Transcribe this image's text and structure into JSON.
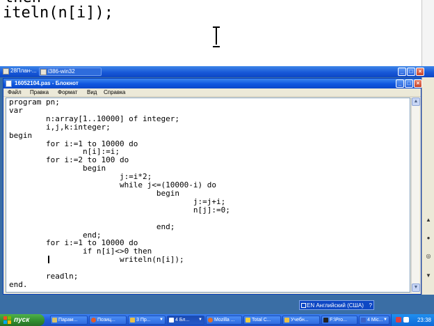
{
  "top_editor": {
    "partial_line": "then",
    "code_line": "iteln(n[i]);"
  },
  "outer_window": {
    "tabs": [
      {
        "label": "28План-..."
      },
      {
        "label": "i386-win32"
      }
    ]
  },
  "notepad": {
    "title": "16052104.pas - Блокнот",
    "menu": [
      "Файл",
      "Правка",
      "Формат",
      "Вид",
      "Справка"
    ],
    "code": "program pn;\nvar\n        n:array[1..10000] of integer;\n        i,j,k:integer;\nbegin\n        for i:=1 to 10000 do\n                n[i]:=i;\n        for i:=2 to 100 do\n                begin\n                        j:=i*2;\n                        while j<=(10000-i) do\n                                begin\n                                        j:=j+i;\n                                        n[j]:=0;\n\n                                end;\n                end;\n        for i:=1 to 10000 do\n                if n[i]<>0 then\n                        writeln(n[i]);\n\n        readln;\nend."
  },
  "language_bar": {
    "label": "EN Английский (США)",
    "help": "?"
  },
  "taskbar": {
    "start_label": "пуск",
    "buttons": [
      {
        "label": "Парам...",
        "color": "#d8c26a"
      },
      {
        "label": "Позиц...",
        "color": "#e05a2a"
      },
      {
        "label": "3 Пр...",
        "color": "#e8c048"
      },
      {
        "label": "4 Бл...",
        "color": "#ffffff"
      },
      {
        "label": "Mozilla ...",
        "color": "#e0702a"
      },
      {
        "label": "Total C...",
        "color": "#f0d040"
      },
      {
        "label": "Учебн...",
        "color": "#e8c048"
      },
      {
        "label": "F:\\Pro...",
        "color": "#222222"
      },
      {
        "label": "4 Mic...",
        "color": "#3a62c8"
      }
    ],
    "clock": "23:38"
  },
  "colors": {
    "xp_blue": "#0f56df",
    "desktop": "#3a6ea5",
    "start_green": "#2f8b2d"
  }
}
